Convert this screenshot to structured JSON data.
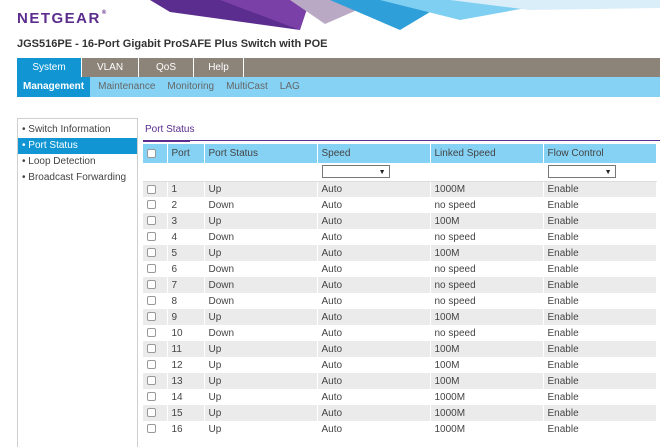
{
  "header": {
    "logo": "NETGEAR",
    "logo_mark": "®",
    "product_title": "JGS516PE - 16-Port Gigabit ProSAFE Plus Switch with POE"
  },
  "main_nav": [
    "System",
    "VLAN",
    "QoS",
    "Help"
  ],
  "sub_nav": [
    "Management",
    "Maintenance",
    "Monitoring",
    "MultiCast",
    "LAG"
  ],
  "sidebar": [
    "Switch Information",
    "Port Status",
    "Loop Detection",
    "Broadcast Forwarding"
  ],
  "content": {
    "title": "Port Status",
    "columns": [
      "Port",
      "Port Status",
      "Speed",
      "Linked Speed",
      "Flow Control"
    ],
    "rows": [
      {
        "port": "1",
        "status": "Up",
        "speed": "Auto",
        "linked": "1000M",
        "flow": "Enable"
      },
      {
        "port": "2",
        "status": "Down",
        "speed": "Auto",
        "linked": "no speed",
        "flow": "Enable"
      },
      {
        "port": "3",
        "status": "Up",
        "speed": "Auto",
        "linked": "100M",
        "flow": "Enable"
      },
      {
        "port": "4",
        "status": "Down",
        "speed": "Auto",
        "linked": "no speed",
        "flow": "Enable"
      },
      {
        "port": "5",
        "status": "Up",
        "speed": "Auto",
        "linked": "100M",
        "flow": "Enable"
      },
      {
        "port": "6",
        "status": "Down",
        "speed": "Auto",
        "linked": "no speed",
        "flow": "Enable"
      },
      {
        "port": "7",
        "status": "Down",
        "speed": "Auto",
        "linked": "no speed",
        "flow": "Enable"
      },
      {
        "port": "8",
        "status": "Down",
        "speed": "Auto",
        "linked": "no speed",
        "flow": "Enable"
      },
      {
        "port": "9",
        "status": "Up",
        "speed": "Auto",
        "linked": "100M",
        "flow": "Enable"
      },
      {
        "port": "10",
        "status": "Down",
        "speed": "Auto",
        "linked": "no speed",
        "flow": "Enable"
      },
      {
        "port": "11",
        "status": "Up",
        "speed": "Auto",
        "linked": "100M",
        "flow": "Enable"
      },
      {
        "port": "12",
        "status": "Up",
        "speed": "Auto",
        "linked": "100M",
        "flow": "Enable"
      },
      {
        "port": "13",
        "status": "Up",
        "speed": "Auto",
        "linked": "100M",
        "flow": "Enable"
      },
      {
        "port": "14",
        "status": "Up",
        "speed": "Auto",
        "linked": "1000M",
        "flow": "Enable"
      },
      {
        "port": "15",
        "status": "Up",
        "speed": "Auto",
        "linked": "1000M",
        "flow": "Enable"
      },
      {
        "port": "16",
        "status": "Up",
        "speed": "Auto",
        "linked": "1000M",
        "flow": "Enable"
      }
    ]
  },
  "icons": {
    "select_arrow": "dropdown-arrow-icon",
    "checkbox": "checkbox-icon"
  },
  "colors": {
    "brand_purple": "#5b2d8e",
    "active_blue": "#1196d3",
    "sub_nav_blue": "#85d2f4",
    "main_nav_gray": "#8c8379"
  }
}
